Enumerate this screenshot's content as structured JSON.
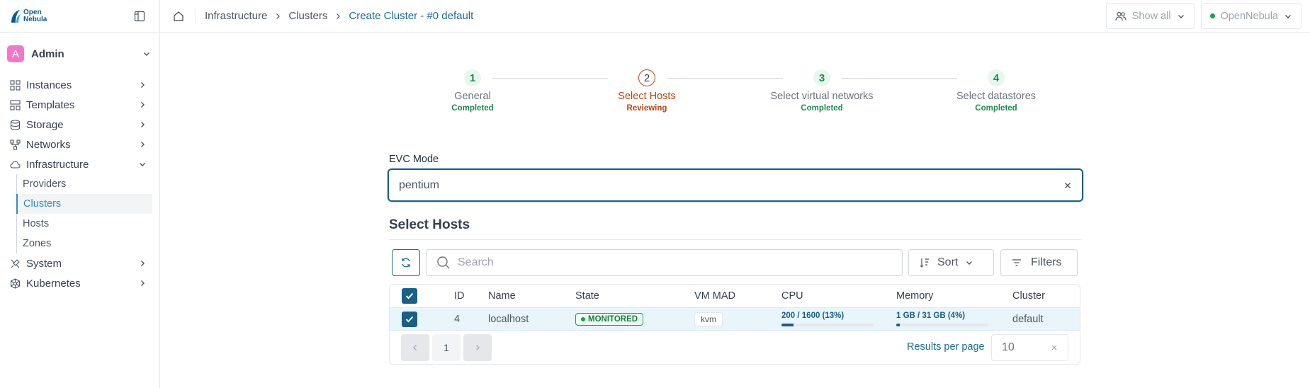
{
  "brand": {
    "line1": "Open",
    "line2": "Nebula"
  },
  "user": {
    "initial": "A",
    "name": "Admin"
  },
  "sidebar": {
    "items": [
      {
        "label": "Instances",
        "icon": "instances-icon"
      },
      {
        "label": "Templates",
        "icon": "templates-icon"
      },
      {
        "label": "Storage",
        "icon": "storage-icon"
      },
      {
        "label": "Networks",
        "icon": "networks-icon"
      },
      {
        "label": "Infrastructure",
        "icon": "cloud-icon"
      },
      {
        "label": "System",
        "icon": "system-icon"
      },
      {
        "label": "Kubernetes",
        "icon": "kubernetes-icon"
      }
    ],
    "infrastructure_sub": [
      "Providers",
      "Clusters",
      "Hosts",
      "Zones"
    ],
    "active_sub": "Clusters"
  },
  "breadcrumb": {
    "items": [
      "Infrastructure",
      "Clusters"
    ],
    "current": "Create Cluster - #0 default"
  },
  "topbar": {
    "show_all": "Show all",
    "zone": "OpenNebula",
    "zone_status_color": "#16a34a"
  },
  "stepper": [
    {
      "num": "1",
      "label": "General",
      "status": "Completed"
    },
    {
      "num": "2",
      "label": "Select Hosts",
      "status": "Reviewing"
    },
    {
      "num": "3",
      "label": "Select virtual networks",
      "status": "Completed"
    },
    {
      "num": "4",
      "label": "Select datastores",
      "status": "Completed"
    }
  ],
  "evc": {
    "label": "EVC Mode",
    "value": "pentium"
  },
  "hosts": {
    "title": "Select Hosts",
    "search_placeholder": "Search",
    "sort_label": "Sort",
    "filters_label": "Filters",
    "columns": [
      "ID",
      "Name",
      "State",
      "VM MAD",
      "CPU",
      "Memory",
      "Cluster"
    ],
    "rows": [
      {
        "id": "4",
        "name": "localhost",
        "state": "MONITORED",
        "vm_mad": "kvm",
        "cpu": "200 / 1600 (13%)",
        "cpu_pct": 13,
        "memory": "1 GB / 31 GB (4%)",
        "memory_pct": 4,
        "cluster": "default"
      }
    ],
    "pagination": {
      "page": "1",
      "results_per_page_label": "Results per page",
      "results_per_page": "10"
    }
  }
}
